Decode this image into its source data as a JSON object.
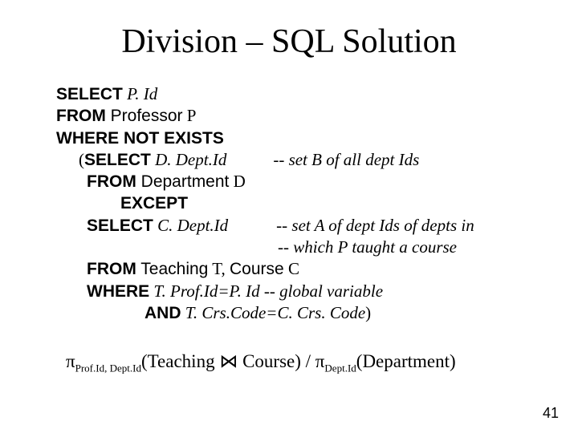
{
  "title": "Division – SQL Solution",
  "sql": {
    "l1_kw": "SELECT",
    "l1_attr": "  P. Id",
    "l2_kw": "FROM",
    "l2_tbl": "  Professor",
    "l2_rest": " P",
    "l3_kw": "WHERE NOT EXISTS",
    "l4_pre": "(",
    "l4_kw": "SELECT",
    "l4_attr": "  D. Dept.Id",
    "l4_comment": "-- set B of all dept Ids",
    "l5_kw": "FROM",
    "l5_tbl": "  Department",
    "l5_rest": " D",
    "l6_kw": "EXCEPT",
    "l7_kw": "SELECT",
    "l7_attr": "  C. Dept.Id",
    "l7_comment": "-- set A of dept Ids of depts in",
    "l7b_comment": "-- which P taught a course",
    "l8_kw": "FROM",
    "l8_tbl1": "  Teaching",
    "l8_mid": " T, ",
    "l8_tbl2": "Course",
    "l8_rest": " C",
    "l9_kw": "WHERE",
    "l9_attr": "  T. Prof.Id=P. Id",
    "l9_comment": "    -- global variable",
    "l10_kw": "AND",
    "l10_attr": "  T. Crs.Code=C. Crs. Code",
    "l10_rest": ")"
  },
  "formula": {
    "pi1": "π",
    "sub1": "Prof.Id, Dept.Id",
    "arg1": "(Teaching ",
    "join": "⋈",
    "arg1b": " Course)  /  ",
    "pi2": "π",
    "sub2": "Dept.Id",
    "arg2": "(Department)"
  },
  "slide_num": "41"
}
